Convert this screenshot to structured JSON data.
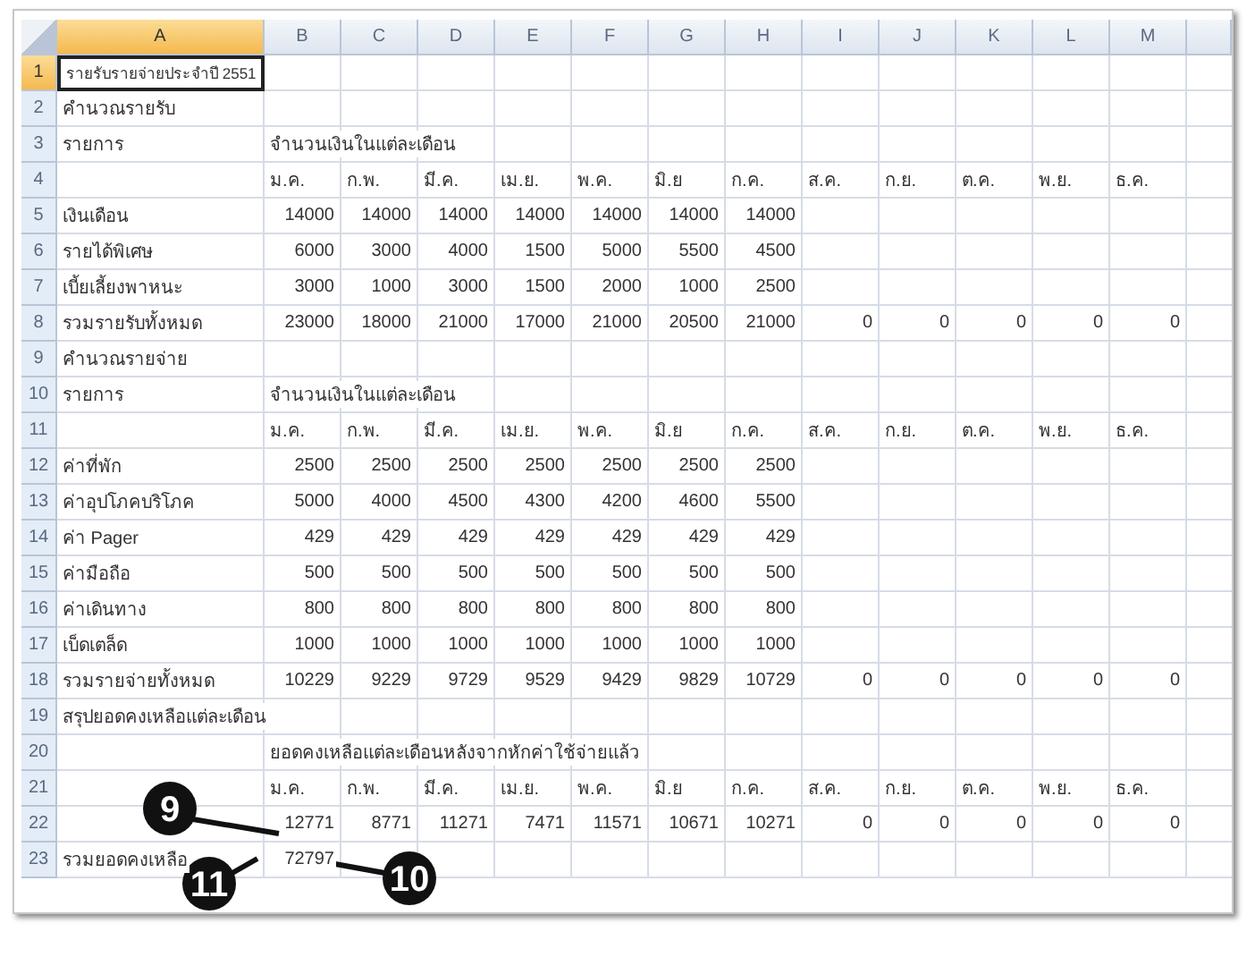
{
  "columns": [
    {
      "label": "A",
      "selected": true
    },
    {
      "label": "B",
      "selected": false
    },
    {
      "label": "C",
      "selected": false
    },
    {
      "label": "D",
      "selected": false
    },
    {
      "label": "E",
      "selected": false
    },
    {
      "label": "F",
      "selected": false
    },
    {
      "label": "G",
      "selected": false
    },
    {
      "label": "H",
      "selected": false
    },
    {
      "label": "I",
      "selected": false
    },
    {
      "label": "J",
      "selected": false
    },
    {
      "label": "K",
      "selected": false
    },
    {
      "label": "L",
      "selected": false
    },
    {
      "label": "M",
      "selected": false
    }
  ],
  "rows": [
    {
      "number": "1",
      "selected": true,
      "kind": "labels",
      "cells": [
        "รายรับรายจ่ายประจำปี 2551"
      ]
    },
    {
      "number": "2",
      "selected": false,
      "kind": "labels",
      "cells": [
        "คำนวณรายรับ"
      ]
    },
    {
      "number": "3",
      "selected": false,
      "kind": "labels",
      "cells": [
        "รายการ",
        "จำนวนเงินในแต่ละเดือน"
      ]
    },
    {
      "number": "4",
      "selected": false,
      "kind": "labels",
      "cells": [
        null,
        "ม.ค.",
        "ก.พ.",
        "มี.ค.",
        "เม.ย.",
        "พ.ค.",
        "มิ.ย",
        "ก.ค.",
        "ส.ค.",
        "ก.ย.",
        "ต.ค.",
        "พ.ย.",
        "ธ.ค."
      ]
    },
    {
      "number": "5",
      "selected": false,
      "kind": "values",
      "cells": [
        "เงินเดือน",
        "14000",
        "14000",
        "14000",
        "14000",
        "14000",
        "14000",
        "14000"
      ]
    },
    {
      "number": "6",
      "selected": false,
      "kind": "values",
      "cells": [
        "รายได้พิเศษ",
        "6000",
        "3000",
        "4000",
        "1500",
        "5000",
        "5500",
        "4500"
      ]
    },
    {
      "number": "7",
      "selected": false,
      "kind": "values",
      "cells": [
        "เบี้ยเลี้ยงพาหนะ",
        "3000",
        "1000",
        "3000",
        "1500",
        "2000",
        "1000",
        "2500"
      ]
    },
    {
      "number": "8",
      "selected": false,
      "kind": "values",
      "cells": [
        "รวมรายรับทั้งหมด",
        "23000",
        "18000",
        "21000",
        "17000",
        "21000",
        "20500",
        "21000",
        "0",
        "0",
        "0",
        "0",
        "0"
      ]
    },
    {
      "number": "9",
      "selected": false,
      "kind": "labels",
      "cells": [
        "คำนวณรายจ่าย"
      ]
    },
    {
      "number": "10",
      "selected": false,
      "kind": "labels",
      "cells": [
        "รายการ",
        "จำนวนเงินในแต่ละเดือน"
      ]
    },
    {
      "number": "11",
      "selected": false,
      "kind": "labels",
      "cells": [
        null,
        "ม.ค.",
        "ก.พ.",
        "มี.ค.",
        "เม.ย.",
        "พ.ค.",
        "มิ.ย",
        "ก.ค.",
        "ส.ค.",
        "ก.ย.",
        "ต.ค.",
        "พ.ย.",
        "ธ.ค."
      ]
    },
    {
      "number": "12",
      "selected": false,
      "kind": "values",
      "cells": [
        "ค่าที่พัก",
        "2500",
        "2500",
        "2500",
        "2500",
        "2500",
        "2500",
        "2500"
      ]
    },
    {
      "number": "13",
      "selected": false,
      "kind": "values",
      "cells": [
        "ค่าอุปโภคบริโภค",
        "5000",
        "4000",
        "4500",
        "4300",
        "4200",
        "4600",
        "5500"
      ]
    },
    {
      "number": "14",
      "selected": false,
      "kind": "values",
      "cells": [
        "ค่า Pager",
        "429",
        "429",
        "429",
        "429",
        "429",
        "429",
        "429"
      ]
    },
    {
      "number": "15",
      "selected": false,
      "kind": "values",
      "cells": [
        "ค่ามือถือ",
        "500",
        "500",
        "500",
        "500",
        "500",
        "500",
        "500"
      ]
    },
    {
      "number": "16",
      "selected": false,
      "kind": "values",
      "cells": [
        "ค่าเดินทาง",
        "800",
        "800",
        "800",
        "800",
        "800",
        "800",
        "800"
      ]
    },
    {
      "number": "17",
      "selected": false,
      "kind": "values",
      "cells": [
        "เบ็ดเตล็ด",
        "1000",
        "1000",
        "1000",
        "1000",
        "1000",
        "1000",
        "1000"
      ]
    },
    {
      "number": "18",
      "selected": false,
      "kind": "values",
      "cells": [
        "รวมรายจ่ายทั้งหมด",
        "10229",
        "9229",
        "9729",
        "9529",
        "9429",
        "9829",
        "10729",
        "0",
        "0",
        "0",
        "0",
        "0"
      ]
    },
    {
      "number": "19",
      "selected": false,
      "kind": "labels",
      "cells": [
        "สรุปยอดคงเหลือแต่ละเดือน"
      ]
    },
    {
      "number": "20",
      "selected": false,
      "kind": "labels",
      "cells": [
        null,
        "ยอดคงเหลือแต่ละเดือนหลังจากหักค่าใช้จ่ายแล้ว"
      ]
    },
    {
      "number": "21",
      "selected": false,
      "kind": "labels",
      "cells": [
        null,
        "ม.ค.",
        "ก.พ.",
        "มี.ค.",
        "เม.ย.",
        "พ.ค.",
        "มิ.ย",
        "ก.ค.",
        "ส.ค.",
        "ก.ย.",
        "ต.ค.",
        "พ.ย.",
        "ธ.ค."
      ]
    },
    {
      "number": "22",
      "selected": false,
      "kind": "values",
      "cells": [
        null,
        "12771",
        "8771",
        "11271",
        "7471",
        "11571",
        "10671",
        "10271",
        "0",
        "0",
        "0",
        "0",
        "0"
      ]
    },
    {
      "number": "23",
      "selected": false,
      "kind": "values",
      "cells": [
        "รวมยอดคงเหลือ",
        "72797"
      ]
    }
  ],
  "callouts": [
    {
      "label": "9"
    },
    {
      "label": "11"
    },
    {
      "label": "10"
    }
  ]
}
